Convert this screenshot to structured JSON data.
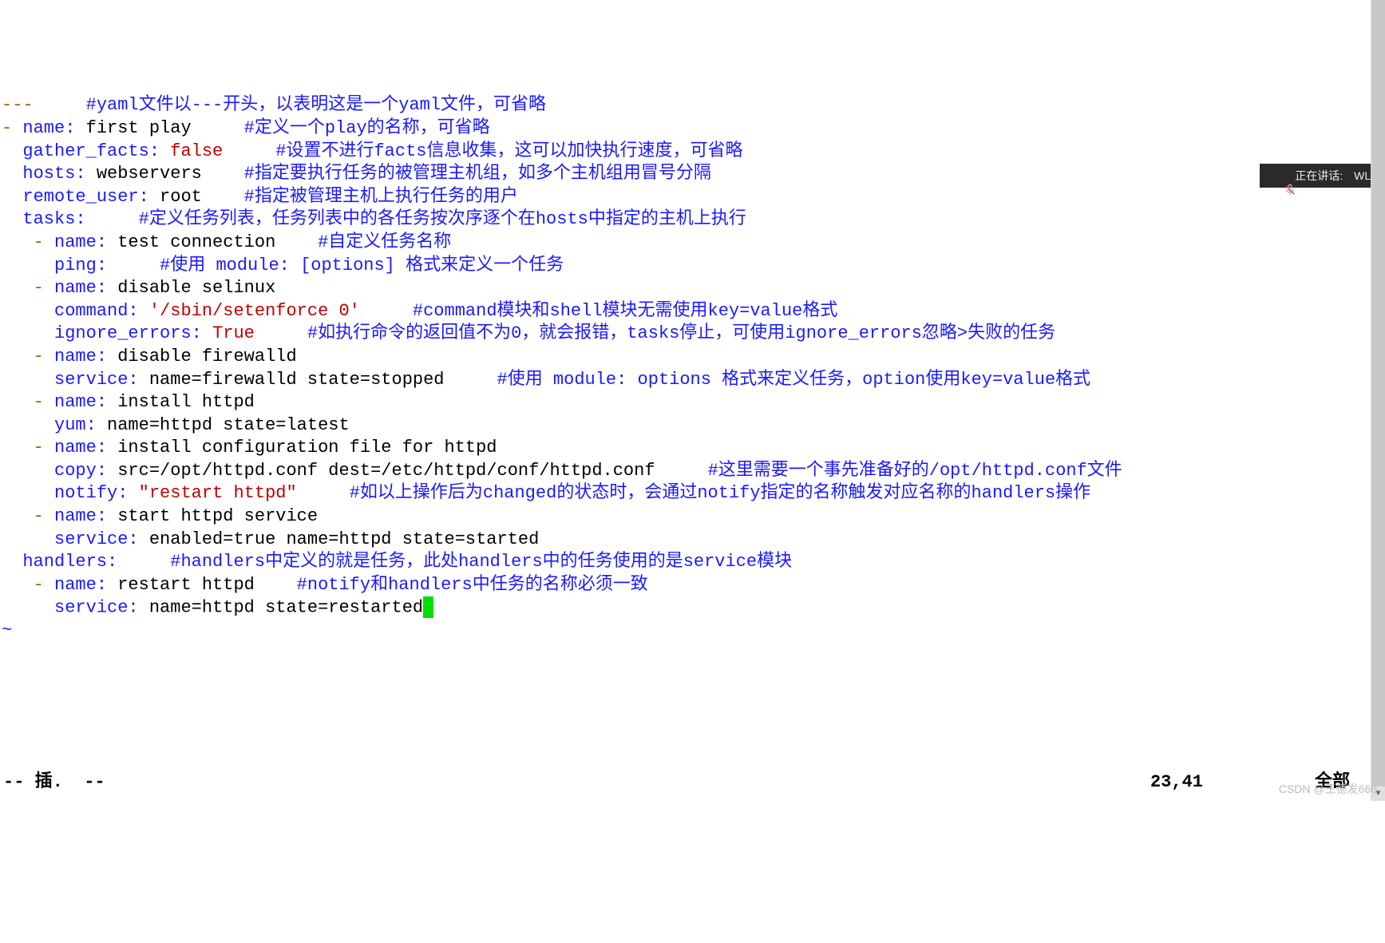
{
  "editor": {
    "lines": [
      {
        "segments": [
          {
            "t": "---",
            "c": "dash"
          },
          {
            "t": "     ",
            "c": "val"
          },
          {
            "t": "#yaml文件以---开头，以表明这是一个yaml文件，可省略",
            "c": "comment"
          }
        ]
      },
      {
        "segments": [
          {
            "t": "- ",
            "c": "dash"
          },
          {
            "t": "name:",
            "c": "kw"
          },
          {
            "t": " first play     ",
            "c": "val"
          },
          {
            "t": "#定义一个play的名称，可省略",
            "c": "comment"
          }
        ]
      },
      {
        "segments": [
          {
            "t": "  ",
            "c": "val"
          },
          {
            "t": "gather_facts:",
            "c": "kw"
          },
          {
            "t": " ",
            "c": "val"
          },
          {
            "t": "false",
            "c": "bool"
          },
          {
            "t": "     ",
            "c": "val"
          },
          {
            "t": "#设置不进行facts信息收集，这可以加快执行速度，可省略",
            "c": "comment"
          }
        ]
      },
      {
        "segments": [
          {
            "t": "  ",
            "c": "val"
          },
          {
            "t": "hosts:",
            "c": "kw"
          },
          {
            "t": " webservers    ",
            "c": "val"
          },
          {
            "t": "#指定要执行任务的被管理主机组，如多个主机组用冒号分隔",
            "c": "comment"
          }
        ]
      },
      {
        "segments": [
          {
            "t": "  ",
            "c": "val"
          },
          {
            "t": "remote_user:",
            "c": "kw"
          },
          {
            "t": " root    ",
            "c": "val"
          },
          {
            "t": "#指定被管理主机上执行任务的用户",
            "c": "comment"
          }
        ]
      },
      {
        "segments": [
          {
            "t": "  ",
            "c": "val"
          },
          {
            "t": "tasks:",
            "c": "kw"
          },
          {
            "t": "     ",
            "c": "val"
          },
          {
            "t": "#定义任务列表，任务列表中的各任务按次序逐个在hosts中指定的主机上执行",
            "c": "comment"
          }
        ]
      },
      {
        "segments": [
          {
            "t": "   - ",
            "c": "dash"
          },
          {
            "t": "name:",
            "c": "kw"
          },
          {
            "t": " test connection    ",
            "c": "val"
          },
          {
            "t": "#自定义任务名称",
            "c": "comment"
          }
        ]
      },
      {
        "segments": [
          {
            "t": "     ",
            "c": "val"
          },
          {
            "t": "ping:",
            "c": "kw"
          },
          {
            "t": "     ",
            "c": "val"
          },
          {
            "t": "#使用 module: [options] 格式来定义一个任务",
            "c": "comment"
          }
        ]
      },
      {
        "segments": [
          {
            "t": "   - ",
            "c": "dash"
          },
          {
            "t": "name:",
            "c": "kw"
          },
          {
            "t": " disable selinux",
            "c": "val"
          }
        ]
      },
      {
        "segments": [
          {
            "t": "     ",
            "c": "val"
          },
          {
            "t": "command:",
            "c": "kw"
          },
          {
            "t": " ",
            "c": "val"
          },
          {
            "t": "'/sbin/setenforce 0'",
            "c": "str"
          },
          {
            "t": "     ",
            "c": "val"
          },
          {
            "t": "#command模块和shell模块无需使用key=value格式",
            "c": "comment"
          }
        ]
      },
      {
        "segments": [
          {
            "t": "     ",
            "c": "val"
          },
          {
            "t": "ignore_errors:",
            "c": "kw"
          },
          {
            "t": " ",
            "c": "val"
          },
          {
            "t": "True",
            "c": "bool"
          },
          {
            "t": "     ",
            "c": "val"
          },
          {
            "t": "#如执行命令的返回值不为0，就会报错，tasks停止，可使用ignore_errors忽略>失败的任务",
            "c": "comment"
          }
        ]
      },
      {
        "segments": [
          {
            "t": "   - ",
            "c": "dash"
          },
          {
            "t": "name:",
            "c": "kw"
          },
          {
            "t": " disable firewalld",
            "c": "val"
          }
        ]
      },
      {
        "segments": [
          {
            "t": "     ",
            "c": "val"
          },
          {
            "t": "service:",
            "c": "kw"
          },
          {
            "t": " name=firewalld state=stopped     ",
            "c": "val"
          },
          {
            "t": "#使用 module: options 格式来定义任务，option使用key=value格式",
            "c": "comment"
          }
        ]
      },
      {
        "segments": [
          {
            "t": "   - ",
            "c": "dash"
          },
          {
            "t": "name:",
            "c": "kw"
          },
          {
            "t": " install httpd",
            "c": "val"
          }
        ]
      },
      {
        "segments": [
          {
            "t": "     ",
            "c": "val"
          },
          {
            "t": "yum:",
            "c": "kw"
          },
          {
            "t": " name=httpd state=latest",
            "c": "val"
          }
        ]
      },
      {
        "segments": [
          {
            "t": "   - ",
            "c": "dash"
          },
          {
            "t": "name:",
            "c": "kw"
          },
          {
            "t": " install configuration file for httpd",
            "c": "val"
          }
        ]
      },
      {
        "segments": [
          {
            "t": "     ",
            "c": "val"
          },
          {
            "t": "copy:",
            "c": "kw"
          },
          {
            "t": " src=/opt/httpd.conf dest=/etc/httpd/conf/httpd.conf     ",
            "c": "val"
          },
          {
            "t": "#这里需要一个事先准备好的/opt/httpd.conf文件",
            "c": "comment"
          }
        ]
      },
      {
        "segments": [
          {
            "t": "     ",
            "c": "val"
          },
          {
            "t": "notify:",
            "c": "kw"
          },
          {
            "t": " ",
            "c": "val"
          },
          {
            "t": "\"restart httpd\"",
            "c": "str"
          },
          {
            "t": "     ",
            "c": "val"
          },
          {
            "t": "#如以上操作后为changed的状态时，会通过notify指定的名称触发对应名称的handlers操作",
            "c": "comment"
          }
        ]
      },
      {
        "segments": [
          {
            "t": "   - ",
            "c": "dash"
          },
          {
            "t": "name:",
            "c": "kw"
          },
          {
            "t": " start httpd service",
            "c": "val"
          }
        ]
      },
      {
        "segments": [
          {
            "t": "     ",
            "c": "val"
          },
          {
            "t": "service:",
            "c": "kw"
          },
          {
            "t": " enabled=true name=httpd state=started",
            "c": "val"
          }
        ]
      },
      {
        "segments": [
          {
            "t": "  ",
            "c": "val"
          },
          {
            "t": "handlers:",
            "c": "kw"
          },
          {
            "t": "     ",
            "c": "val"
          },
          {
            "t": "#handlers中定义的就是任务，此处handlers中的任务使用的是service模块",
            "c": "comment"
          }
        ]
      },
      {
        "segments": [
          {
            "t": "   - ",
            "c": "dash"
          },
          {
            "t": "name:",
            "c": "kw"
          },
          {
            "t": " restart httpd    ",
            "c": "val"
          },
          {
            "t": "#notify和handlers中任务的名称必须一致",
            "c": "comment"
          }
        ]
      },
      {
        "segments": [
          {
            "t": "     ",
            "c": "val"
          },
          {
            "t": "service:",
            "c": "kw"
          },
          {
            "t": " name=httpd state=restarted",
            "c": "val"
          },
          {
            "t": "",
            "c": "cursor-here"
          }
        ]
      },
      {
        "segments": [
          {
            "t": "~",
            "c": "tilde"
          }
        ]
      }
    ]
  },
  "status": {
    "mode": "-- 插.  --",
    "position": "23,41",
    "scroll": "全部"
  },
  "overlay": {
    "mic_label": "正在讲话:",
    "speaker": "WL;"
  },
  "watermark": "CSDN @王德发666"
}
